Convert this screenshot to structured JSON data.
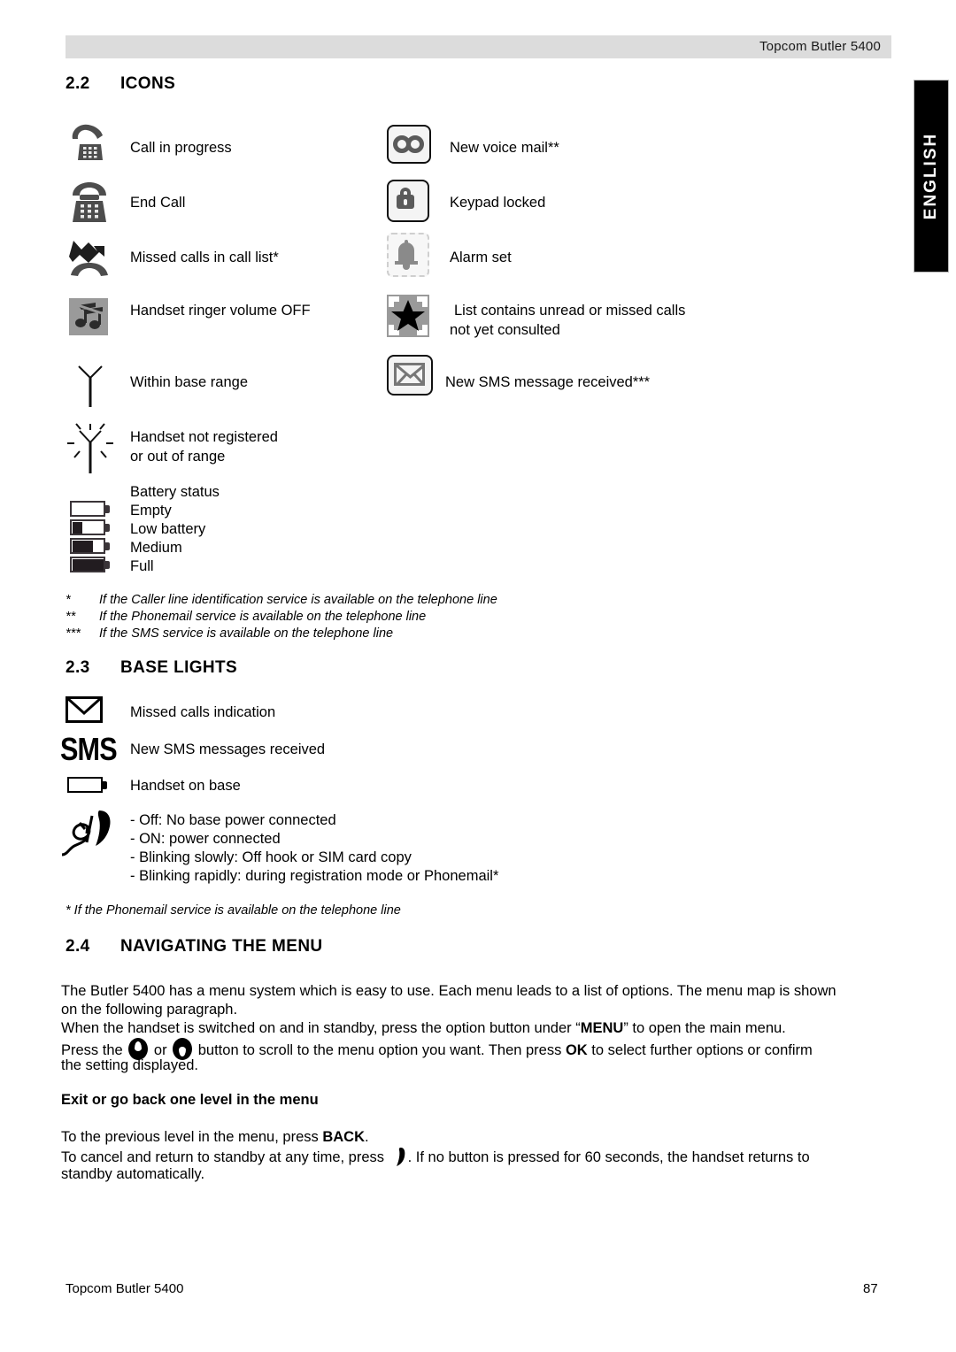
{
  "header": {
    "title": "Topcom Butler 5400"
  },
  "lang_tab": {
    "label": "ENGLISH"
  },
  "sections": {
    "icons": {
      "number": "2.2",
      "title": "ICONS"
    },
    "base_lights": {
      "number": "2.3",
      "title": "BASE LIGHTS"
    },
    "navigating": {
      "number": "2.4",
      "title": "NAVIGATING THE MENU"
    }
  },
  "icon_rows_left": [
    {
      "icon": "handset-off-hook-phone-icon",
      "label": "Call in progress"
    },
    {
      "icon": "phone-on-hook-icon",
      "label": "End Call"
    },
    {
      "icon": "missed-call-arrow-icon",
      "label": "Missed calls in call list*"
    },
    {
      "icon": "ringer-off-icon",
      "label": "Handset ringer volume OFF"
    },
    {
      "icon": "antenna-in-range-icon",
      "label": "Within base range"
    },
    {
      "icon": "antenna-out-of-range-icon",
      "label_line1": "Handset not registered",
      "label_line2": "or out of range"
    }
  ],
  "icon_rows_right": [
    {
      "icon": "voicemail-icon",
      "label": "New voice mail**"
    },
    {
      "icon": "keypad-lock-icon",
      "label": "Keypad locked"
    },
    {
      "icon": "alarm-bell-icon",
      "label": "Alarm set"
    },
    {
      "icon": "star-list-icon",
      "label_line1": "List contains unread or missed calls",
      "label_line2": "not yet consulted"
    },
    {
      "icon": "sms-envelope-icon",
      "label": "New SMS message received***"
    }
  ],
  "battery": {
    "title": "Battery status",
    "levels": [
      {
        "icon": "battery-empty-icon",
        "label": "Empty",
        "fill": 0
      },
      {
        "icon": "battery-low-icon",
        "label": "Low battery",
        "fill": 33
      },
      {
        "icon": "battery-medium-icon",
        "label": "Medium",
        "fill": 66
      },
      {
        "icon": "battery-full-icon",
        "label": "Full",
        "fill": 100
      }
    ]
  },
  "footnotes_icons": [
    {
      "marker": "*",
      "text": "If the Caller line identification service is available on the telephone line"
    },
    {
      "marker": "**",
      "text": "If the Phonemail service is available on the telephone line"
    },
    {
      "marker": "***",
      "text": "If the SMS service is available on the telephone line"
    }
  ],
  "base_light_rows": [
    {
      "icon": "envelope-outline-icon",
      "label": "Missed calls indication"
    },
    {
      "icon": "sms-text-icon",
      "label": "New SMS messages received"
    },
    {
      "icon": "handset-on-base-icon",
      "label": "Handset on base"
    }
  ],
  "base_light_sms_glyph": "SMS",
  "power_light": {
    "icon": "power-plug-handset-icon",
    "lines": [
      "- Off: No base power connected",
      "- ON: power connected",
      "- Blinking slowly: Off hook or SIM card copy",
      "- Blinking rapidly: during registration mode or Phonemail*"
    ]
  },
  "footnote_base": "* If the Phonemail service is available on the telephone line",
  "navigating": {
    "p1_line1": "The Butler 5400 has a menu system which is easy to use. Each menu leads to a list of options. The menu map is shown",
    "p1_line2": "on the following paragraph.",
    "p2_line1_a": "When the handset is switched on and in standby, press the option button under “",
    "p2_menu": "MENU",
    "p2_line1_b": "” to open the main menu.",
    "p2_line2_a": "Press the",
    "p2_or": "or",
    "p2_line2_b": "button to scroll to the menu option you want. Then press",
    "p2_ok": "OK",
    "p2_line2_c": "to select further options or confirm",
    "p2_line3": "the setting displayed.",
    "exit_heading": "Exit or go back one level in the menu",
    "exit_line1_a": "To the previous level in the menu, press",
    "exit_back": "BACK",
    "exit_line1_b": ".",
    "exit_line2_a": "To cancel and return to standby at any time, press",
    "exit_line2_b": ". If no button is pressed for 60 seconds, the handset returns to",
    "exit_line3": "standby automatically."
  },
  "footer": {
    "left": "Topcom Butler 5400",
    "right": "87"
  },
  "colors": {
    "header_bg": "#dcdcdc",
    "tab_bg": "#000000",
    "icon_gray": "#5a5a5a"
  }
}
